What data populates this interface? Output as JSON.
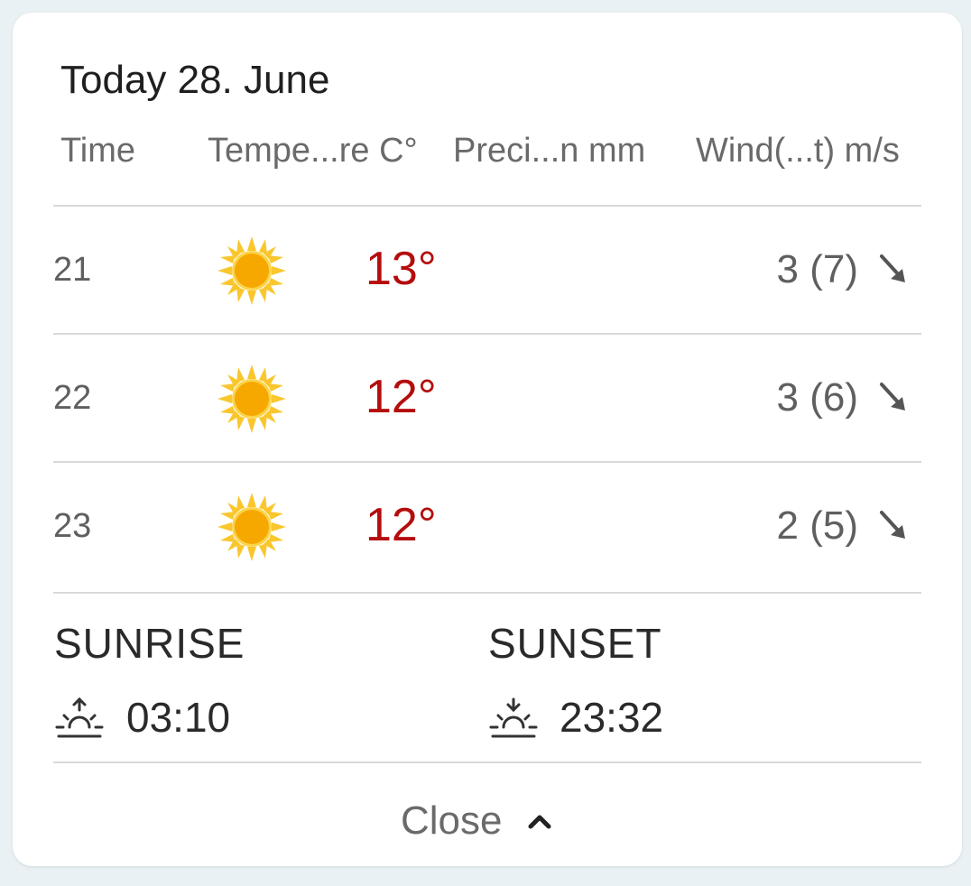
{
  "panel": {
    "title": "Today 28. June"
  },
  "columns": {
    "time": "Time",
    "temperature": "Tempe...re C°",
    "precipitation": "Preci...n mm",
    "wind": "Wind(...t) m/s"
  },
  "rows": [
    {
      "time": "21",
      "icon": "sun-icon",
      "temperature": "13°",
      "precipitation": "",
      "wind": "3 (7)",
      "wind_icon": "arrow-down-right-icon"
    },
    {
      "time": "22",
      "icon": "sun-icon",
      "temperature": "12°",
      "precipitation": "",
      "wind": "3 (6)",
      "wind_icon": "arrow-down-right-icon"
    },
    {
      "time": "23",
      "icon": "sun-icon",
      "temperature": "12°",
      "precipitation": "",
      "wind": "2 (5)",
      "wind_icon": "arrow-down-right-icon"
    }
  ],
  "sun": {
    "sunrise_label": "SUNRISE",
    "sunrise_time": "03:10",
    "sunset_label": "SUNSET",
    "sunset_time": "23:32"
  },
  "footer": {
    "close_label": "Close"
  },
  "colors": {
    "temperature": "#b50c0c",
    "sun": "#f7a800",
    "divider": "#d7dadb"
  }
}
